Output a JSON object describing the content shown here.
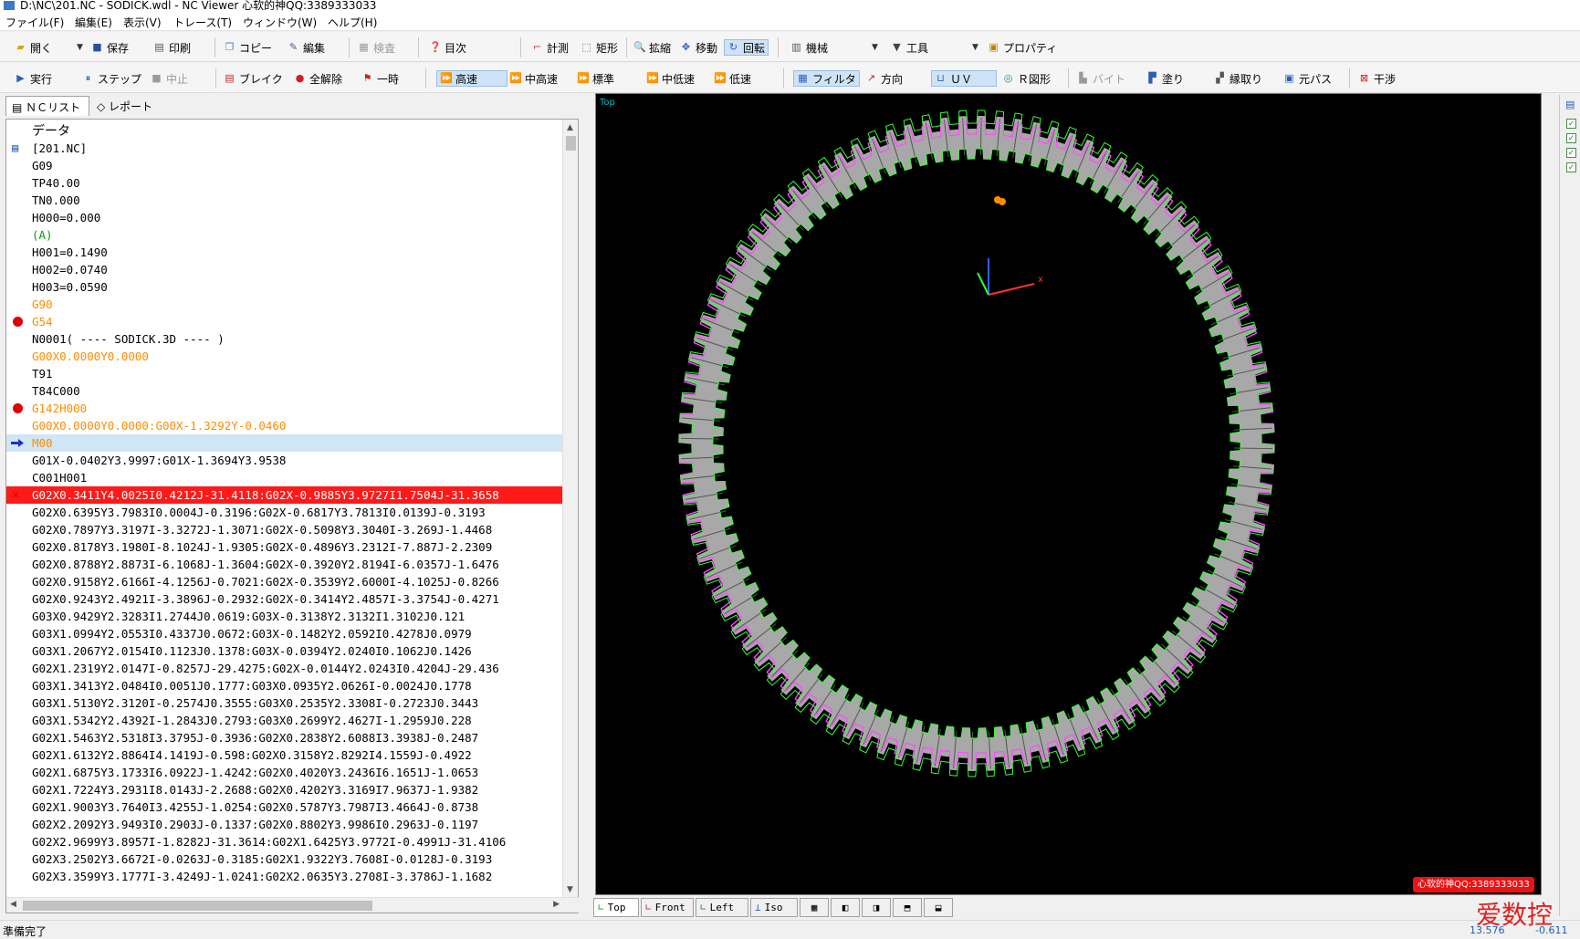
{
  "window": {
    "title": "D:\\NC\\201.NC - SODICK.wdl - NC Viewer 心软的神QQ:3389333033"
  },
  "menu": [
    "ファイル(F)",
    "編集(E)",
    "表示(V)",
    "トレース(T)",
    "ウィンドウ(W)",
    "ヘルプ(H)"
  ],
  "toolbar1": {
    "open": "開く",
    "save": "保存",
    "print": "印刷",
    "copy": "コピー",
    "edit": "編集",
    "inspect": "検査",
    "toc": "目次",
    "measure": "計測",
    "rect": "矩形",
    "zoom": "拡縮",
    "move": "移動",
    "rotate": "回転",
    "machine": "機械",
    "tools": "工具",
    "property": "プロパティ"
  },
  "toolbar2": {
    "run": "実行",
    "step": "ステップ",
    "stop": "中止",
    "break": "ブレイク",
    "release_all": "全解除",
    "pause": "一時",
    "speed_fast": "高速",
    "speed_midfast": "中高速",
    "speed_std": "標準",
    "speed_midslow": "中低速",
    "speed_slow": "低速",
    "filter": "フィルタ",
    "direction": "方向",
    "uv": "ＵＶ",
    "r_shape": "Ｒ図形",
    "bite": "バイト",
    "fill": "塗り",
    "edge": "縁取り",
    "origin_path": "元パス",
    "interference": "干渉"
  },
  "left_tabs": {
    "nclist": "ＮＣリスト",
    "report": "レポート"
  },
  "nc": {
    "header": "データ",
    "lines": [
      {
        "text": "[201.NC]",
        "style": "normal",
        "mark": "file"
      },
      {
        "text": "G09",
        "style": "normal",
        "mark": ""
      },
      {
        "text": "TP40.00",
        "style": "normal",
        "mark": ""
      },
      {
        "text": "TN0.000",
        "style": "normal",
        "mark": ""
      },
      {
        "text": "H000=0.000",
        "style": "normal",
        "mark": ""
      },
      {
        "text": "(A)",
        "style": "green",
        "mark": ""
      },
      {
        "text": "H001=0.1490",
        "style": "normal",
        "mark": ""
      },
      {
        "text": "H002=0.0740",
        "style": "normal",
        "mark": ""
      },
      {
        "text": "H003=0.0590",
        "style": "normal",
        "mark": ""
      },
      {
        "text": "G90",
        "style": "orange",
        "mark": ""
      },
      {
        "text": "G54",
        "style": "orange",
        "mark": "dot"
      },
      {
        "text": "N0001( ---- SODICK.3D ---- )",
        "style": "normal",
        "mark": ""
      },
      {
        "text": "G00X0.0000Y0.0000",
        "style": "orange",
        "mark": ""
      },
      {
        "text": "T91",
        "style": "normal",
        "mark": ""
      },
      {
        "text": "T84C000",
        "style": "normal",
        "mark": ""
      },
      {
        "text": "G142H000",
        "style": "orange",
        "mark": "dot"
      },
      {
        "text": "G00X0.0000Y0.0000:G00X-1.3292Y-0.0460",
        "style": "orange",
        "mark": ""
      },
      {
        "text": "M00",
        "style": "hl",
        "mark": "arrow"
      },
      {
        "text": "G01X-0.0402Y3.9997:G01X-1.3694Y3.9538",
        "style": "normal",
        "mark": ""
      },
      {
        "text": "C001H001",
        "style": "normal",
        "mark": ""
      },
      {
        "text": "G02X0.3411Y4.0025I0.4212J-31.4118:G02X-0.9885Y3.9727I1.7504J-31.3658",
        "style": "err",
        "mark": "x"
      },
      {
        "text": "G02X0.6395Y3.7983I0.0004J-0.3196:G02X-0.6817Y3.7813I0.0139J-0.3193",
        "style": "normal",
        "mark": ""
      },
      {
        "text": "G02X0.7897Y3.3197I-3.3272J-1.3071:G02X-0.5098Y3.3040I-3.269J-1.4468",
        "style": "normal",
        "mark": ""
      },
      {
        "text": "G02X0.8178Y3.1980I-8.1024J-1.9305:G02X-0.4896Y3.2312I-7.887J-2.2309",
        "style": "normal",
        "mark": ""
      },
      {
        "text": "G02X0.8788Y2.8873I-6.1068J-1.3604:G02X-0.3920Y2.8194I-6.0357J-1.6476",
        "style": "normal",
        "mark": ""
      },
      {
        "text": "G02X0.9158Y2.6166I-4.1256J-0.7021:G02X-0.3539Y2.6000I-4.1025J-0.8266",
        "style": "normal",
        "mark": ""
      },
      {
        "text": "G02X0.9243Y2.4921I-3.3896J-0.2932:G02X-0.3414Y2.4857I-3.3754J-0.4271",
        "style": "normal",
        "mark": ""
      },
      {
        "text": "G03X0.9429Y2.3283I1.2744J0.0619:G03X-0.3138Y2.3132I1.3102J0.121",
        "style": "normal",
        "mark": ""
      },
      {
        "text": "G03X1.0994Y2.0553I0.4337J0.0672:G03X-0.1482Y2.0592I0.4278J0.0979",
        "style": "normal",
        "mark": ""
      },
      {
        "text": "G03X1.2067Y2.0154I0.1123J0.1378:G03X-0.0394Y2.0240I0.1062J0.1426",
        "style": "normal",
        "mark": ""
      },
      {
        "text": "G02X1.2319Y2.0147I-0.8257J-29.4275:G02X-0.0144Y2.0243I0.4204J-29.436",
        "style": "normal",
        "mark": ""
      },
      {
        "text": "G03X1.3413Y2.0484I0.0051J0.1777:G03X0.0935Y2.0626I-0.0024J0.1778",
        "style": "normal",
        "mark": ""
      },
      {
        "text": "G03X1.5130Y2.3120I-0.2574J0.3555:G03X0.2535Y2.3308I-0.2723J0.3443",
        "style": "normal",
        "mark": ""
      },
      {
        "text": "G03X1.5342Y2.4392I-1.2843J0.2793:G03X0.2699Y2.4627I-1.2959J0.228",
        "style": "normal",
        "mark": ""
      },
      {
        "text": "G02X1.5463Y2.5318I3.3795J-0.3936:G02X0.2838Y2.6088I3.3938J-0.2487",
        "style": "normal",
        "mark": ""
      },
      {
        "text": "G02X1.6132Y2.8864I4.1419J-0.598:G02X0.3158Y2.8292I4.1559J-0.4922",
        "style": "normal",
        "mark": ""
      },
      {
        "text": "G02X1.6875Y3.1733I6.0922J-1.4242:G02X0.4020Y3.2436I6.1651J-1.0653",
        "style": "normal",
        "mark": ""
      },
      {
        "text": "G02X1.7224Y3.2931I8.0143J-2.2688:G02X0.4202Y3.3169I7.9637J-1.9382",
        "style": "normal",
        "mark": ""
      },
      {
        "text": "G02X1.9003Y3.7640I3.4255J-1.0254:G02X0.5787Y3.7987I3.4664J-0.8738",
        "style": "normal",
        "mark": ""
      },
      {
        "text": "G02X2.2092Y3.9493I0.2903J-0.1337:G02X0.8802Y3.9986I0.2963J-0.1197",
        "style": "normal",
        "mark": ""
      },
      {
        "text": "G02X2.9699Y3.8957I-1.8282J-31.3614:G02X1.6425Y3.9772I-0.4991J-31.4106",
        "style": "normal",
        "mark": ""
      },
      {
        "text": "G02X3.2502Y3.6672I-0.0263J-0.3185:G02X1.9322Y3.7608I-0.0128J-0.3193",
        "style": "normal",
        "mark": ""
      },
      {
        "text": "G02X3.3599Y3.1777I-3.4249J-1.0241:G02X2.0635Y3.2708I-3.3786J-1.1682",
        "style": "normal",
        "mark": ""
      }
    ]
  },
  "viewer": {
    "label": "Top",
    "watermark": "心软的神QQ:3389333033",
    "tabs": [
      "Top",
      "Front",
      "Left",
      "Iso"
    ],
    "gear": {
      "teeth": 100
    },
    "colors": {
      "bg": "#000000",
      "fill": "#a8a8a8",
      "outer": "#ff4dff",
      "inner": "#33ff33"
    }
  },
  "status": {
    "text": "準備完了",
    "x": "13.576",
    "y": "-0.611"
  },
  "brand": "爱数控",
  "colors": {
    "error_row": "#ff1a1a",
    "orange": "#ff8c00",
    "green": "#00a000",
    "highlight": "#cfe6f7"
  }
}
